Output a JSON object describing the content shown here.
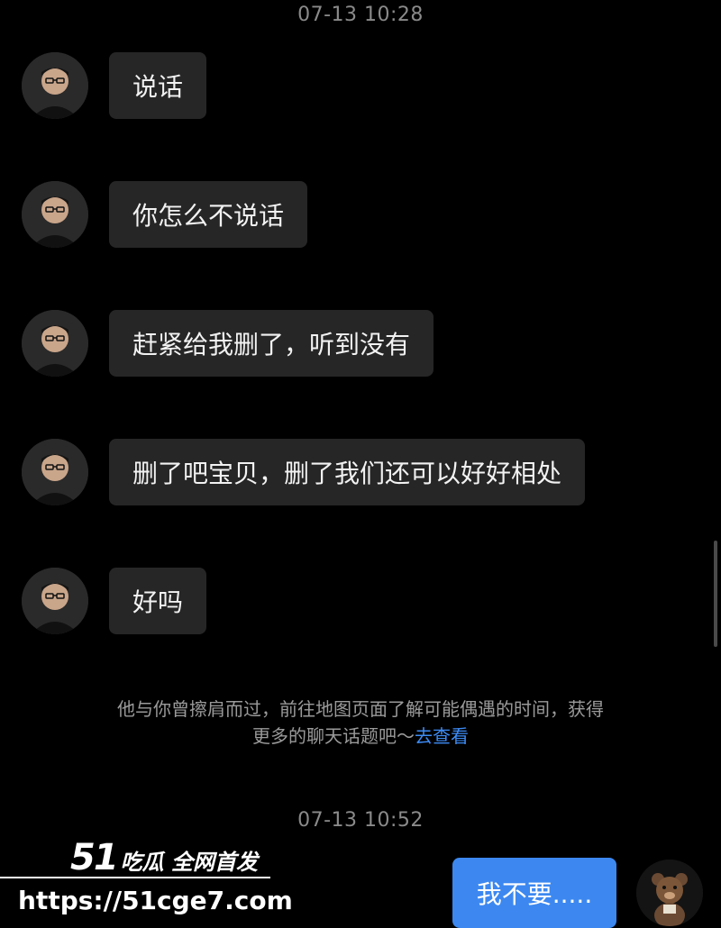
{
  "chat": {
    "timestamps": [
      "07-13 10:28",
      "07-13 10:52"
    ],
    "incoming_messages": [
      {
        "text": "说话"
      },
      {
        "text": "你怎么不说话"
      },
      {
        "text": "赶紧给我删了，听到没有"
      },
      {
        "text": "删了吧宝贝，删了我们还可以好好相处"
      },
      {
        "text": "好吗"
      }
    ],
    "system_note": {
      "line1": "他与你曾擦肩而过，前往地图页面了解可能偶遇的时间，获得",
      "line2": "更多的聊天话题吧～",
      "link": "去查看"
    },
    "outgoing_messages": [
      {
        "text": "我不要....."
      }
    ]
  },
  "icons": {
    "sender_avatar": "person-photo-icon",
    "my_avatar": "teddy-bear-icon"
  },
  "colors": {
    "background": "#000000",
    "incoming_bubble": "#262626",
    "outgoing_bubble": "#3c88f0",
    "link": "#3d8bf5"
  },
  "watermark": {
    "brand_number": "51",
    "brand_text": "吃瓜 全网首发",
    "url": "https://51cge7.com"
  }
}
